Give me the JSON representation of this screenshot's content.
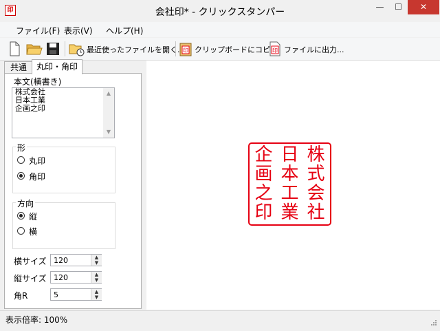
{
  "window": {
    "title": "会社印* - クリックスタンパー",
    "app_icon": "印",
    "minimize": "—",
    "maximize": "☐",
    "close": "✕"
  },
  "menu": [
    "ファイル(F)",
    "表示(V)",
    "ヘルプ(H)"
  ],
  "toolbar": {
    "icons": [
      "new-file-icon",
      "open-folder-icon",
      "save-disk-icon",
      "recent-files-icon",
      "clipboard-stamp-icon",
      "file-output-icon"
    ],
    "recent_label": "最近使ったファイルを開く...",
    "copy_label": "クリップボードにコピー",
    "output_label": "ファイルに出力..."
  },
  "tabs": [
    "共通",
    "丸印・角印"
  ],
  "body": {
    "label": "本文(横書き)",
    "text": "株式会社\n日本工業\n企画之印"
  },
  "shape": {
    "title": "形",
    "options": [
      "丸印",
      "角印"
    ],
    "selected": 1
  },
  "direction": {
    "title": "方向",
    "options": [
      "縦",
      "横"
    ],
    "selected": 0
  },
  "fields": [
    {
      "label": "横サイズ",
      "value": "120"
    },
    {
      "label": "縦サイズ",
      "value": "120"
    },
    {
      "label": "角R",
      "value": "5"
    }
  ],
  "stamp": {
    "color": "#e60012",
    "columns": [
      [
        "株",
        "式",
        "会",
        "社"
      ],
      [
        "日",
        "本",
        "工",
        "業"
      ],
      [
        "企",
        "画",
        "之",
        "印"
      ]
    ]
  },
  "status": {
    "text": "表示倍率: 100%"
  }
}
